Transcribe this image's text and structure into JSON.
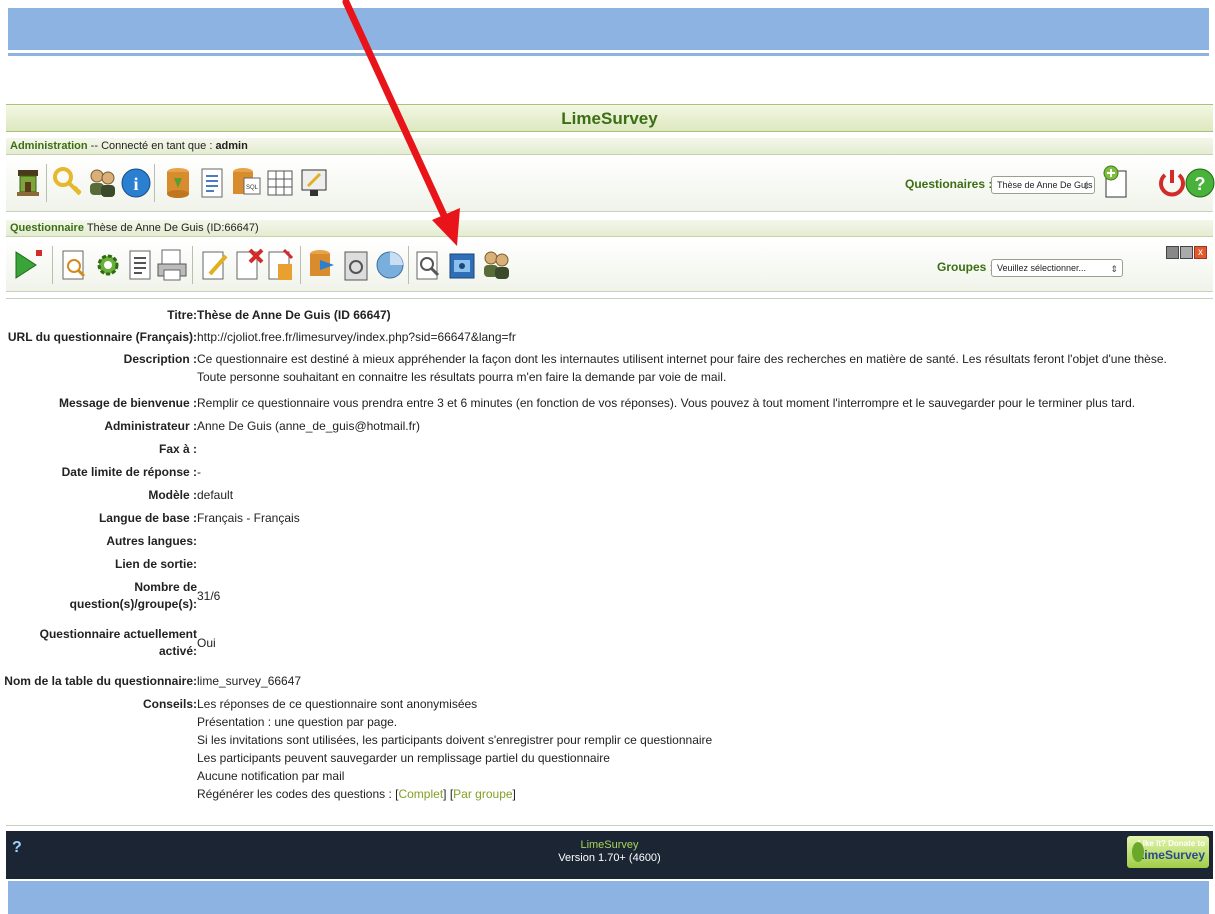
{
  "app": {
    "title": "LimeSurvey"
  },
  "admin_bar": {
    "label": "Administration",
    "sep": " -- Connecté en tant que : ",
    "user": "admin"
  },
  "admin_toolbar": {
    "icons": [
      "home-icon",
      "key-icon",
      "users-icon",
      "info-icon",
      "import-icon",
      "document-icon",
      "sql-icon",
      "grid-icon",
      "edit-icon"
    ],
    "questionnaires_label": "Questionaires :",
    "questionnaires_selected": "Thèse de Anne De Guis"
  },
  "survey_bar": {
    "label": "Questionnaire",
    "text": " Thèse de Anne De Guis (ID:66647)"
  },
  "survey_toolbar": {
    "icons": [
      "activate-icon",
      "preview-icon",
      "settings-icon",
      "document-icon",
      "print-icon",
      "edit-icon",
      "delete-icon",
      "export-icon",
      "import-icon",
      "assessment-icon",
      "quota-icon",
      "browse-icon",
      "folder-icon",
      "participants-icon"
    ],
    "groups_label": "Groupes :",
    "groups_placeholder": "Veuillez sélectionner..."
  },
  "details": {
    "titre": {
      "label": "Titre:",
      "value": "Thèse de Anne De Guis (ID 66647)"
    },
    "url": {
      "label": "URL du questionnaire (Français):",
      "value": "http://cjoliot.free.fr/limesurvey/index.php?sid=66647&lang=fr"
    },
    "description": {
      "label": "Description :",
      "value": "Ce questionnaire est destiné à mieux appréhender la façon dont les internautes utilisent internet pour faire des recherches en matière de santé. Les résultats feront l'objet d'une thèse. Toute personne souhaitant en connaitre les résultats pourra m'en faire la demande par voie de mail."
    },
    "welcome": {
      "label": "Message de bienvenue :",
      "value": "Remplir ce questionnaire vous prendra entre 3 et 6 minutes (en fonction de vos réponses). Vous pouvez à tout moment l'interrompre et le sauvegarder pour le terminer plus tard."
    },
    "admin": {
      "label": "Administrateur :",
      "value": "Anne De Guis (anne_de_guis@hotmail.fr)"
    },
    "fax": {
      "label": "Fax à :",
      "value": ""
    },
    "deadline": {
      "label": "Date limite de réponse :",
      "value": "-"
    },
    "template": {
      "label": "Modèle :",
      "value": "default"
    },
    "base_lang": {
      "label": "Langue de base :",
      "value": "Français - Français"
    },
    "other_langs": {
      "label": "Autres langues:",
      "value": ""
    },
    "exit_link": {
      "label": "Lien de sortie:",
      "value": ""
    },
    "count": {
      "label_1": "Nombre de",
      "label_2": "question(s)/groupe(s):",
      "value": "31/6"
    },
    "active": {
      "label_1": "Questionnaire actuellement",
      "label_2": "activé:",
      "value": "Oui"
    },
    "table": {
      "label": "Nom de la table du questionnaire:",
      "value": "lime_survey_66647"
    },
    "tips": {
      "label": "Conseils:",
      "lines": [
        "Les réponses de ce questionnaire sont anonymisées",
        "Présentation : une question par page.",
        "Si les invitations sont utilisées, les participants doivent s'enregistrer pour remplir ce questionnaire",
        "Les participants peuvent sauvegarder un remplissage partiel du questionnaire",
        "Aucune notification par mail"
      ],
      "regen_prefix": "Régénérer les codes des questions : ",
      "regen_full": "Complet",
      "regen_group": "Par groupe"
    }
  },
  "footer": {
    "help": "?",
    "name": "LimeSurvey",
    "version": "Version 1.70+ (4600)",
    "donate_line1": "Like it? Donate to",
    "donate_line2": "LimeSurvey"
  },
  "colors": {
    "band": "#8db3e2",
    "accent": "#3c6e14",
    "link": "#81a025",
    "footer": "#1b2534",
    "arrow": "#e8141a"
  }
}
